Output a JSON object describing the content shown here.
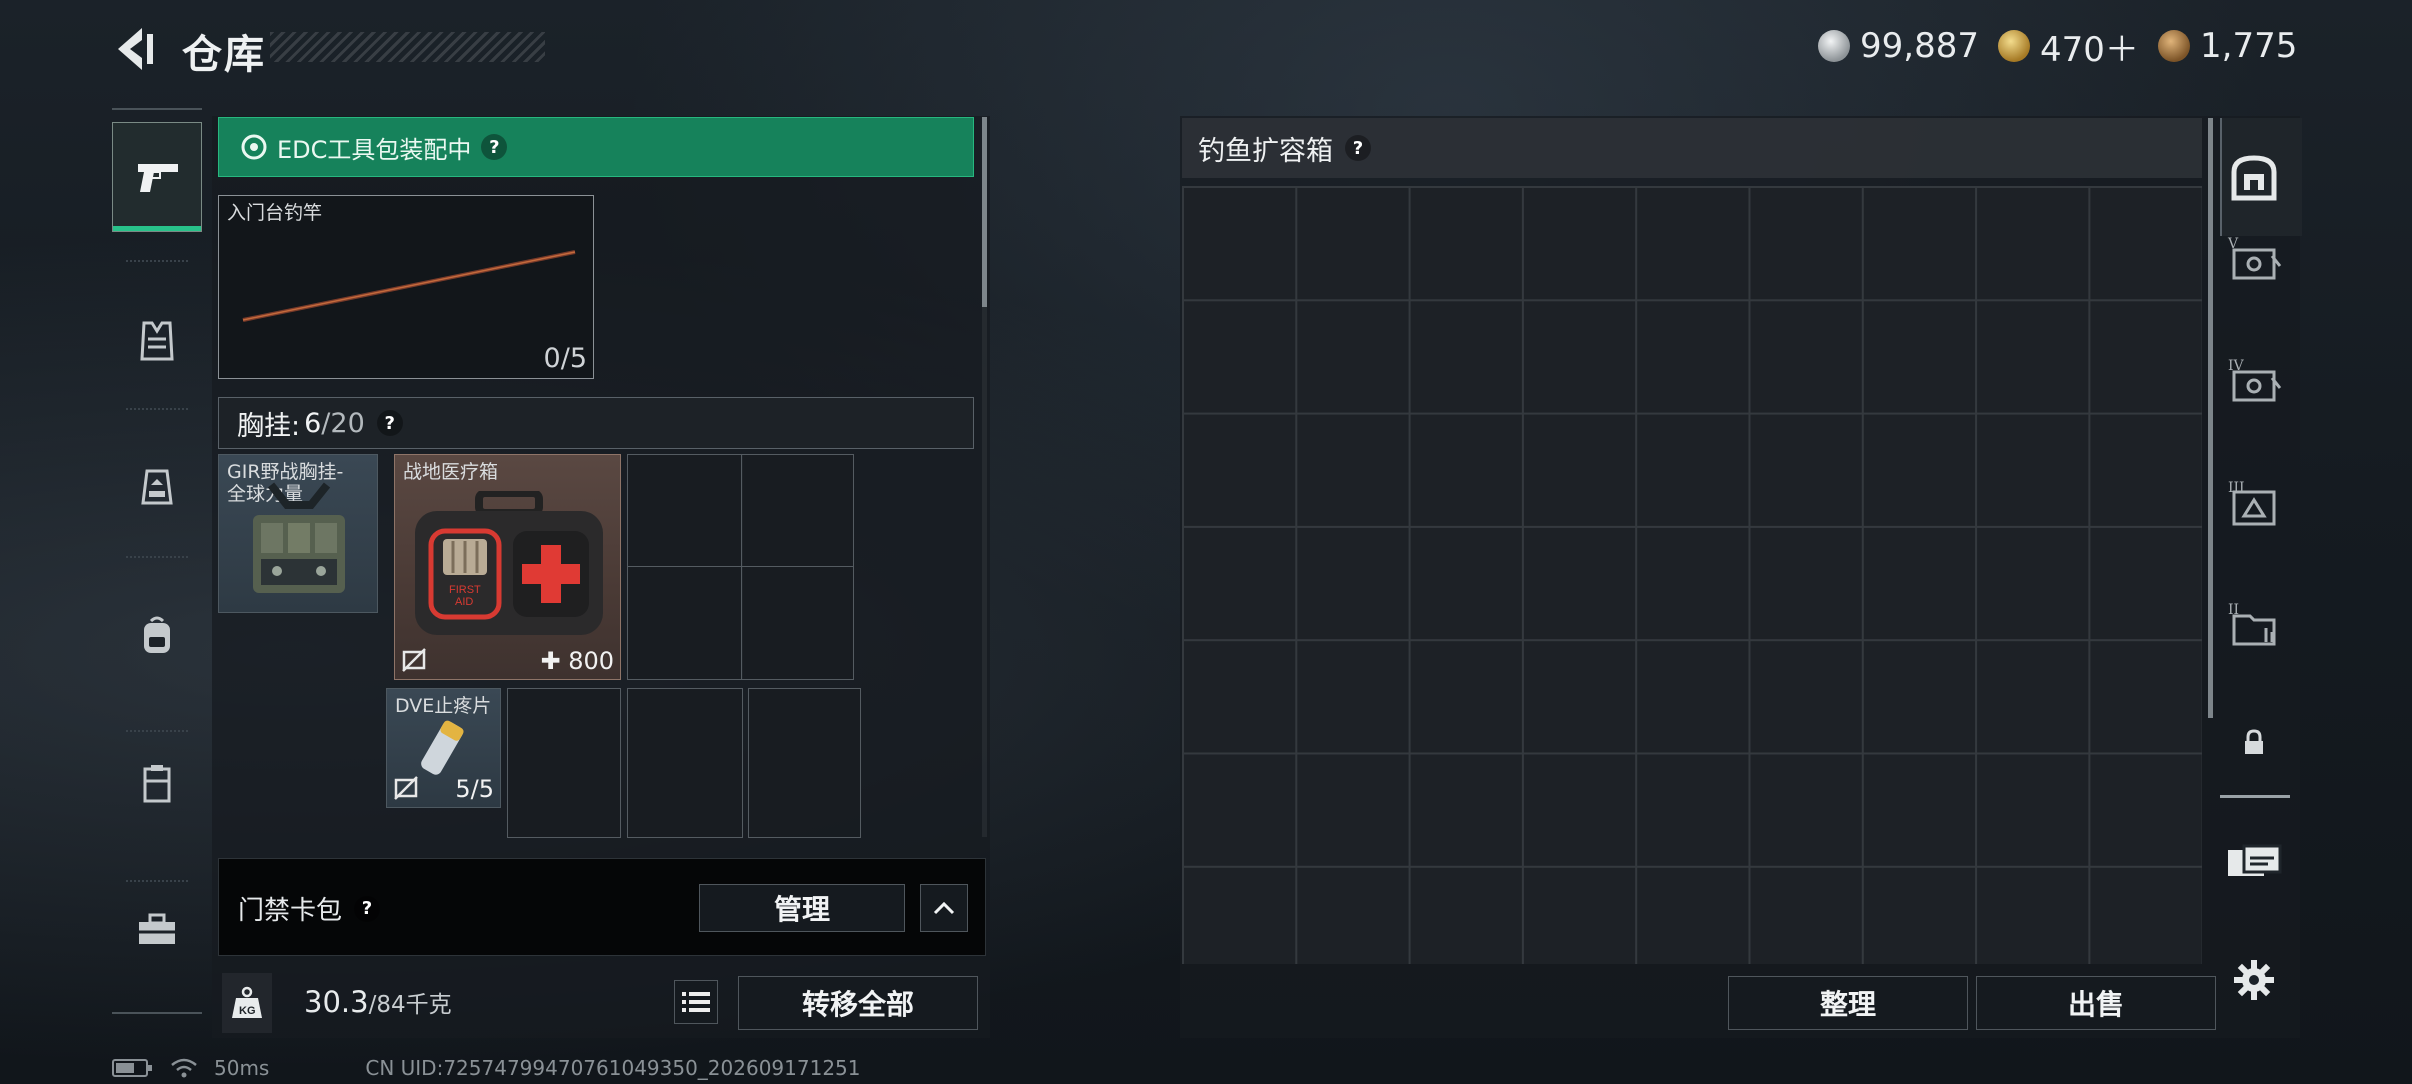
{
  "header": {
    "title": "仓库",
    "currencies": [
      {
        "value": "99,887",
        "icon": "silver-coin-icon",
        "color": "#bfc4c7"
      },
      {
        "value": "470＋",
        "icon": "gold-triangle-coin-icon",
        "color": "#c9a24a"
      },
      {
        "value": "1,775",
        "icon": "bronze-coin-icon",
        "color": "#a87a3c"
      }
    ]
  },
  "nav": {
    "items": [
      "pistol-icon",
      "armor-vest-icon",
      "chest-rig-icon",
      "backpack-icon",
      "container-case-icon",
      "toolbox-icon"
    ],
    "active_index": 0
  },
  "inventory": {
    "edc_status": "EDC工具包装配中",
    "help": "?",
    "rod": {
      "name": "入门台钓竿",
      "count": "0/5"
    },
    "vest": {
      "label": "胸挂:",
      "current": "6",
      "capacity": "/20"
    },
    "vest_item": {
      "name": "GIR野战胸挂-全球力量"
    },
    "medkit": {
      "name": "战地医疗箱",
      "durability": "800",
      "print_line1": "FIRST",
      "print_line2": "AID"
    },
    "bandage": {
      "name": "DVE止疼片",
      "count": "5/5"
    },
    "keycard": {
      "label": "门禁卡包",
      "manage": "管理"
    },
    "weight": {
      "current": "30.3",
      "max": "/84千克"
    },
    "transfer_all": "转移全部"
  },
  "container": {
    "title": "钓鱼扩容箱",
    "help": "?",
    "sort_button": "整理",
    "sell_button": "出售",
    "selector_icons": [
      "safe-box-icon",
      "container-v-icon",
      "container-iv-icon",
      "container-iii-icon",
      "container-ii-icon",
      "lock-icon",
      "tickets-icon",
      "gear-icon"
    ],
    "selector_labels": [
      "V",
      "IV",
      "III",
      "II"
    ]
  },
  "footer": {
    "ping": "50ms",
    "uid": "CN UID:72574799470761049350_202609171251"
  }
}
